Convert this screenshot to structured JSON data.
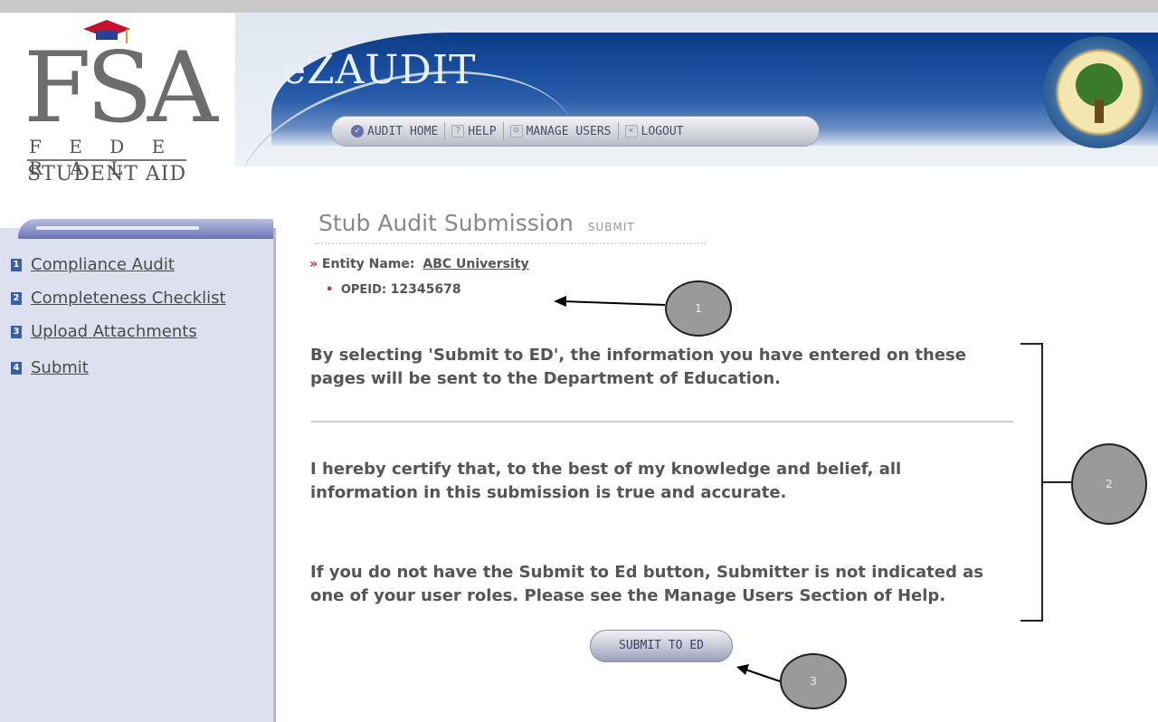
{
  "logo": {
    "letters": "FSA",
    "line1": "F E D E R A L",
    "line2": "STUDENT AID"
  },
  "app": {
    "title": "eZAUDIT"
  },
  "nav": {
    "items": [
      {
        "label": "AUDIT HOME",
        "icon": "audit-home-icon"
      },
      {
        "label": "HELP",
        "icon": "help-icon"
      },
      {
        "label": "MANAGE USERS",
        "icon": "manage-users-icon"
      },
      {
        "label": "LOGOUT",
        "icon": "logout-icon"
      }
    ]
  },
  "sidebar": {
    "items": [
      {
        "num": "1",
        "label": "Compliance Audit"
      },
      {
        "num": "2",
        "label": "Completeness Checklist"
      },
      {
        "num": "3",
        "label": "Upload Attachments"
      },
      {
        "num": "4",
        "label": "Submit"
      }
    ]
  },
  "main": {
    "title": "Stub Audit Submission",
    "subtitle": "SUBMIT",
    "entity_label": "Entity Name:",
    "entity_value": "ABC University",
    "opeid_label": "OPEID:",
    "opeid_value": "12345678",
    "para1": "By selecting 'Submit to ED', the information you have entered on these pages will be sent to the Department of Education.",
    "para2": "I hereby certify that, to the best of my knowledge and belief, all information in this submission is true and accurate.",
    "para3": "If you do not have the Submit to Ed button, Submitter is not indicated as one of your user roles. Please see the Manage Users Section of Help.",
    "submit_label": "SUBMIT TO ED"
  },
  "callouts": [
    "1",
    "2",
    "3"
  ],
  "colors": {
    "banner_blue": "#1a4f9f",
    "sidebar_bg": "#dde0ef",
    "required_marker": "#cc3333"
  }
}
